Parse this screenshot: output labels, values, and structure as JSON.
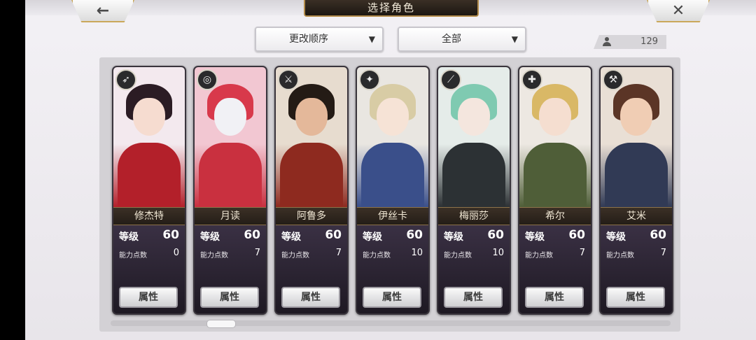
{
  "header": {
    "title": "选择角色",
    "back_icon": "←",
    "close_icon": "✕"
  },
  "controls": {
    "sort_label": "更改顺序",
    "filter_label": "全部",
    "dropdown_arrow": "▼",
    "character_count": "129"
  },
  "card_common": {
    "level_label": "等级",
    "ability_points_label": "能力点数",
    "attribute_button_label": "属性"
  },
  "characters": [
    {
      "name": "修杰特",
      "level": "60",
      "ability_points": "0",
      "weapon_icon": "bow-icon",
      "weapon_glyph": "➶",
      "palette": {
        "bg": "#f3e9ee",
        "hair": "#2b1c24",
        "face": "#f6dcd0",
        "outfit": "#b3202a"
      }
    },
    {
      "name": "月读",
      "level": "60",
      "ability_points": "7",
      "weapon_icon": "ring-icon",
      "weapon_glyph": "◎",
      "palette": {
        "bg": "#f2c7d2",
        "hair": "#d8394b",
        "face": "#f1f1f5",
        "outfit": "#c9303f"
      }
    },
    {
      "name": "阿鲁多",
      "level": "60",
      "ability_points": "7",
      "weapon_icon": "sword-icon",
      "weapon_glyph": "⚔",
      "palette": {
        "bg": "#e7dccf",
        "hair": "#241b15",
        "face": "#e4b89a",
        "outfit": "#8e2a1f"
      }
    },
    {
      "name": "伊丝卡",
      "level": "60",
      "ability_points": "10",
      "weapon_icon": "blade-icon",
      "weapon_glyph": "✦",
      "palette": {
        "bg": "#e9e6e1",
        "hair": "#d8cca5",
        "face": "#f6e3d6",
        "outfit": "#3a4f8a"
      }
    },
    {
      "name": "梅丽莎",
      "level": "60",
      "ability_points": "10",
      "weapon_icon": "spear-icon",
      "weapon_glyph": "⟋",
      "palette": {
        "bg": "#e5ece9",
        "hair": "#7fcab1",
        "face": "#f4e6de",
        "outfit": "#2c3134"
      }
    },
    {
      "name": "希尔",
      "level": "60",
      "ability_points": "7",
      "weapon_icon": "staff-icon",
      "weapon_glyph": "✚",
      "palette": {
        "bg": "#ede8e2",
        "hair": "#d9b866",
        "face": "#f5ded0",
        "outfit": "#4f5e38"
      }
    },
    {
      "name": "艾米",
      "level": "60",
      "ability_points": "7",
      "weapon_icon": "hammer-icon",
      "weapon_glyph": "⚒",
      "palette": {
        "bg": "#e9dfd5",
        "hair": "#5b3526",
        "face": "#f0cdb4",
        "outfit": "#313a55"
      }
    }
  ],
  "scrollbar": {
    "position": 0.18
  }
}
